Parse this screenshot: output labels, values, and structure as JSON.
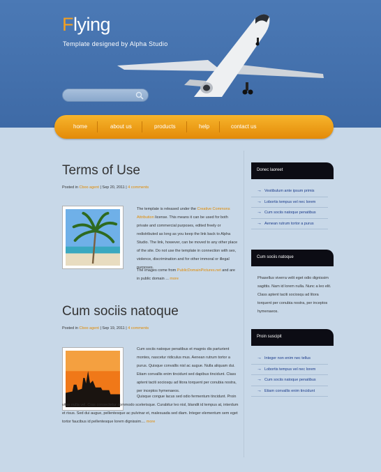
{
  "header": {
    "logo_first": "F",
    "logo_rest": "lying",
    "tagline": "Template designed by Alpha Studio"
  },
  "nav": {
    "items": [
      "home",
      "about us",
      "products",
      "help",
      "contact us"
    ]
  },
  "posts": [
    {
      "title": "Terms of Use",
      "meta_prefix": "Posted in",
      "meta_author": "Cboo agent",
      "meta_date": "| Sep 20, 2011 |",
      "meta_comments": "4 comments",
      "para1_a": "The template is released under the",
      "para1_link": "Creative Commons Attribution",
      "para1_b": "license. This means it can be used for both private and commercial purposes, edited freely or redistributed as long as you keep the link back to Alpha Studio. The link, however, can be moved to any other place of the site. Do not use the template in connection with sex, violence, discrimination and for other immoral or illegal purposes.",
      "para2_a": "The images come from",
      "para2_link": "PublicDomainPictures.net",
      "para2_b": "and are in public domain ...",
      "more": "more"
    },
    {
      "title": "Cum sociis natoque",
      "meta_prefix": "Posted in",
      "meta_author": "Cboo agent",
      "meta_date": "| Sep 19, 2011 |",
      "meta_comments": "4 comments",
      "para1": "Cum sociis natoque penatibus et magnis dis parturient montes, nascetur ridiculus mus. Aenean rutrum tortor a purus. Quisque convallis nisl ac augue. Nulla aliquam dui. Etiam convallis enim tincidunt sed dapibus tincidunt. Class aptent taciti sociosqu ad litora torquent per conubia nostra, per inceptos hymenaeos.",
      "para2": "Quisque congue lacus sed odio fermentum tincidunt. Proin vitae nulla vel. Cras consectetur commodo scelerisque. Curabitur leo nisl, blandit id tempus at, interdum et risus. Sed dui augue, pellentesque ac pulvinar et, malesuada sed diam. Integer elementum sem eget tortor faucibus id pellentesque lorem dignissim....",
      "more": "more"
    }
  ],
  "sidebar": {
    "widgets": [
      {
        "title": "Donec laoreet",
        "items": [
          "Vestibulum ante ipsum primis",
          "Lobortis tempus vel nec lorem",
          "Cum sociis natoque penatibus",
          "Aenean rutrum tortor a purus"
        ]
      },
      {
        "title": "Cum sociis natoque",
        "text": "Phasellus viverra velit eget odio dignissim sagittis. Nam id lorem nulla. Nunc a leo elit. Class aptent taciti sociosqu ad litora torquent per conubia nostra, per inceptos hymenaeos."
      },
      {
        "title": "Proin suscipit",
        "items": [
          "Integer non enim nec tellus",
          "Lobortis tempus vel nec lorem",
          "Cum sociis natoque penatibus",
          "Etiam convallis enim tincidunt"
        ]
      }
    ]
  },
  "colors": {
    "header_blue": "#4470ad",
    "accent_orange": "#f4a020",
    "page_bg": "#c8d8e8",
    "link_blue": "#1a3a8a"
  }
}
